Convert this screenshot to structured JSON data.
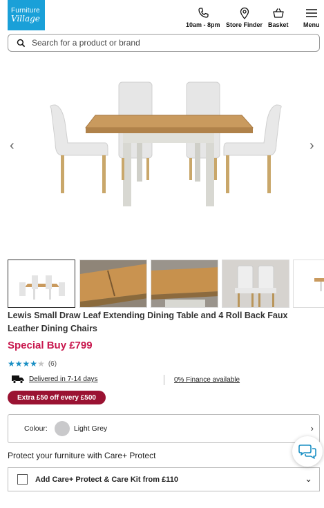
{
  "brand": {
    "logo_line1": "Furniture",
    "logo_line2": "Village",
    "color": "#1aa0d8"
  },
  "header": {
    "hours_label": "10am - 8pm",
    "store_finder_label": "Store Finder",
    "basket_label": "Basket",
    "menu_label": "Menu",
    "icons": [
      "phone-icon",
      "location-pin-icon",
      "basket-icon",
      "hamburger-menu-icon"
    ]
  },
  "search": {
    "placeholder": "Search for a product or brand",
    "value": ""
  },
  "gallery": {
    "prev_icon": "‹",
    "next_icon": "›",
    "thumbnail_count": 5
  },
  "product": {
    "title": "Lewis Small Draw Leaf Extending Dining Table and 4 Roll Back Faux Leather Dining Chairs",
    "price": "Special Buy £799",
    "price_color": "#c8174d",
    "rating_stars": 4,
    "rating_max": 5,
    "rating_count": "(6)",
    "star_color": "#1a8fc4"
  },
  "delivery": {
    "text": "Delivered in 7-14 days",
    "icon": "delivery-truck-icon"
  },
  "finance": {
    "text": "0% Finance available"
  },
  "promo": {
    "text": "Extra £50 off every £500",
    "color": "#9a1232"
  },
  "colour_selector": {
    "label": "Colour:",
    "value": "Light Grey",
    "swatch": "#c9c9cb",
    "chevron": "›"
  },
  "protection": {
    "heading": "Protect your furniture with Care+ Protect",
    "option_label": "Add Care+ Protect & Care Kit from £110",
    "checked": false,
    "chevron": "⌄"
  },
  "chat": {
    "icon": "chat-bubbles-icon",
    "color": "#1a8fc4"
  }
}
